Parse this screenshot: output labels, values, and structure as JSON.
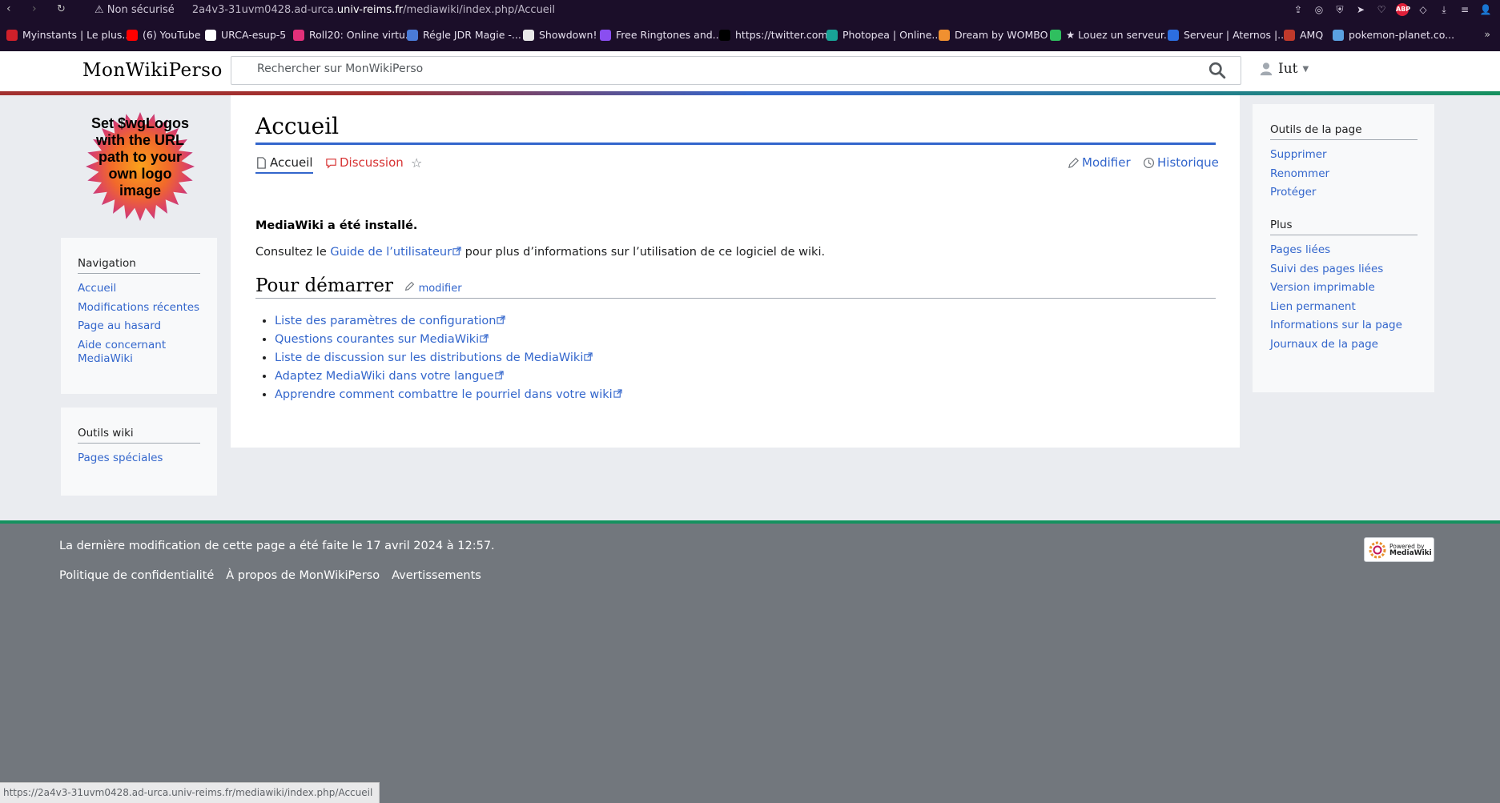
{
  "browser": {
    "security_label": "Non sécurisé",
    "url_prefix": "2a4v3-31uvm0428.ad-urca.",
    "url_domain": "univ-reims.fr",
    "url_path": "/mediawiki/index.php/Accueil",
    "bookmarks": [
      {
        "label": "Myinstants | Le plus...",
        "color": "#d0202a"
      },
      {
        "label": "(6) YouTube",
        "color": "#ff0000"
      },
      {
        "label": "URCA-esup-5",
        "color": "#ffffff"
      },
      {
        "label": "Roll20: Online virtu...",
        "color": "#e2307a"
      },
      {
        "label": "Régle JDR Magie -...",
        "color": "#4a7bd8"
      },
      {
        "label": "Showdown!",
        "color": "#e8e8e8"
      },
      {
        "label": "Free Ringtones and...",
        "color": "#8a4ef0"
      },
      {
        "label": "https://twitter.com",
        "color": "#000000"
      },
      {
        "label": "Photopea | Online...",
        "color": "#18a497"
      },
      {
        "label": "Dream by WOMBO",
        "color": "#f09030"
      },
      {
        "label": "★ Louez un serveur...",
        "color": "#2fbf5f"
      },
      {
        "label": "Serveur | Aternos |...",
        "color": "#2c6ee0"
      },
      {
        "label": "AMQ",
        "color": "#c0392b"
      },
      {
        "label": "pokemon-planet.co...",
        "color": "#5aa0e0"
      }
    ],
    "more": "»",
    "status_url": "https://2a4v3-31uvm0428.ad-urca.univ-reims.fr/mediawiki/index.php/Accueil"
  },
  "header": {
    "wordmark": "MonWikiPerso",
    "search_placeholder": "Rechercher sur MonWikiPerso",
    "user": "Iut"
  },
  "logo_text": "Set $wgLogos with the URL path to your own logo image",
  "sidebar": {
    "navigation": {
      "heading": "Navigation",
      "items": [
        "Accueil",
        "Modifications récentes",
        "Page au hasard",
        "Aide concernant MediaWiki"
      ]
    },
    "tools": {
      "heading": "Outils wiki",
      "items": [
        "Pages spéciales"
      ]
    }
  },
  "right_sidebar": {
    "page_tools": {
      "heading": "Outils de la page",
      "items": [
        "Supprimer",
        "Renommer",
        "Protéger"
      ]
    },
    "more": {
      "heading": "Plus",
      "items": [
        "Pages liées",
        "Suivi des pages liées",
        "Version imprimable",
        "Lien permanent",
        "Informations sur la page",
        "Journaux de la page"
      ]
    }
  },
  "content": {
    "title": "Accueil",
    "tabs": {
      "page": "Accueil",
      "discussion": "Discussion",
      "edit": "Modifier",
      "history": "Historique"
    },
    "lead": "MediaWiki a été installé.",
    "para_before": "Consultez le ",
    "para_link": "Guide de l’utilisateur",
    "para_after": " pour plus d’informations sur l’utilisation de ce logiciel de wiki.",
    "section_title": "Pour démarrer",
    "section_edit": "modifier",
    "links": [
      "Liste des paramètres de configuration",
      "Questions courantes sur MediaWiki",
      "Liste de discussion sur les distributions de MediaWiki",
      "Adaptez MediaWiki dans votre langue",
      "Apprendre comment combattre le pourriel dans votre wiki"
    ]
  },
  "footer": {
    "last_modified": "La dernière modification de cette page a été faite le 17 avril 2024 à 12:57.",
    "links": [
      "Politique de confidentialité",
      "À propos de MonWikiPerso",
      "Avertissements"
    ],
    "powered_line1": "Powered by",
    "powered_line2": "MediaWiki"
  }
}
